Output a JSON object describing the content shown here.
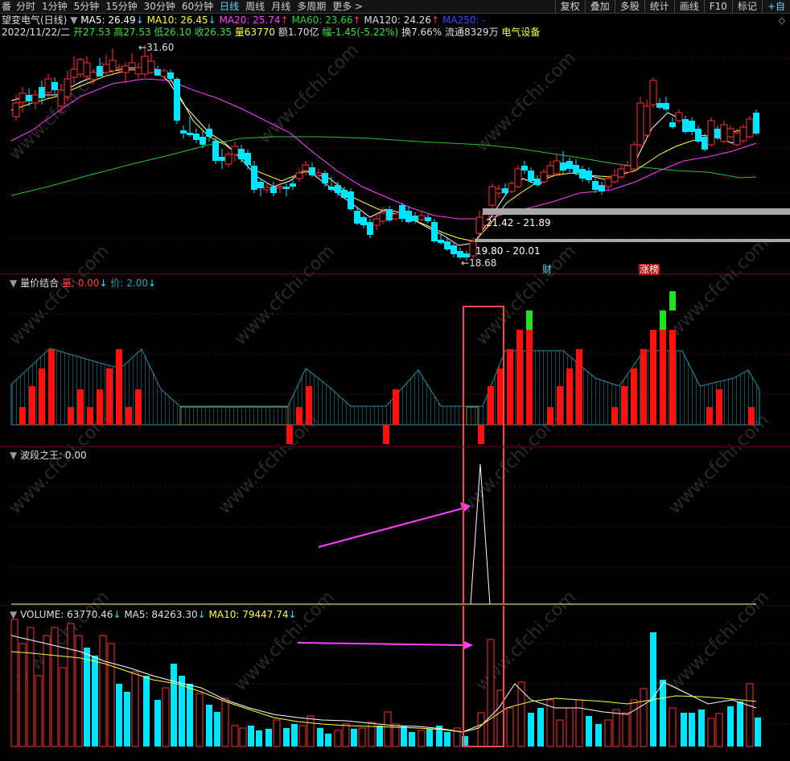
{
  "toolbar": {
    "left_tab": "番",
    "periods": [
      "分时",
      "1分钟",
      "5分钟",
      "15分钟",
      "30分钟",
      "60分钟",
      "日线",
      "周线",
      "月线",
      "多周期",
      "更多 >"
    ],
    "active": "日线",
    "right": [
      "复权",
      "叠加",
      "多股",
      "统计",
      "画线",
      "F10",
      "标记",
      "+自"
    ]
  },
  "main": {
    "title": "望变电气(日线)",
    "ma5": "MA5: 26.49",
    "ma5_arrow": "↓",
    "ma10": "MA10: 26.45",
    "ma10_arrow": "↓",
    "ma20": "MA20: 25.74",
    "ma20_arrow": "↑",
    "ma60": "MA60: 23.66",
    "ma60_arrow": "↑",
    "ma120": "MA120: 24.26",
    "ma120_arrow": "↑",
    "ma250": "MA250: -",
    "date": "2022/11/22/二",
    "open": "开27.53",
    "high": "高27.53",
    "low": "低26.10",
    "close": "收26.35",
    "vol": "量63770",
    "amount": "额1.70亿",
    "change": "幅-1.45(-5.22%)",
    "turnover": "换7.66%",
    "float": "流通8329万",
    "sector": "电气设备",
    "price_high": "31.60",
    "price_low": "18.68",
    "zone1": "21.42 - 21.89",
    "zone2": "19.80 - 20.01",
    "marker_cai": "财",
    "marker_zhang": "涨榜"
  },
  "ind1": {
    "title": "量价结合",
    "liang": "量: 0.00",
    "liang_arrow": "↓",
    "jia": "价: 2.00",
    "jia_arrow": "↓"
  },
  "ind2": {
    "title": "波段之王",
    "value": ": 0.00"
  },
  "volume": {
    "vol": "VOLUME: 63770.46",
    "vol_arrow": "↓",
    "ma5": "MA5: 84263.30",
    "ma5_arrow": "↓",
    "ma10": "MA10: 79447.74",
    "ma10_arrow": "↓"
  },
  "colors": {
    "up": "#ff3232",
    "down": "#00e5ff",
    "ma5": "#ffffff",
    "ma10": "#ffff40",
    "ma20": "#ff40ff",
    "ma60": "#30c030",
    "grid": "#5a1010",
    "highlight": "#ff4444",
    "arrow": "#ff40ff"
  },
  "watermark": "www.cfchi.com"
}
